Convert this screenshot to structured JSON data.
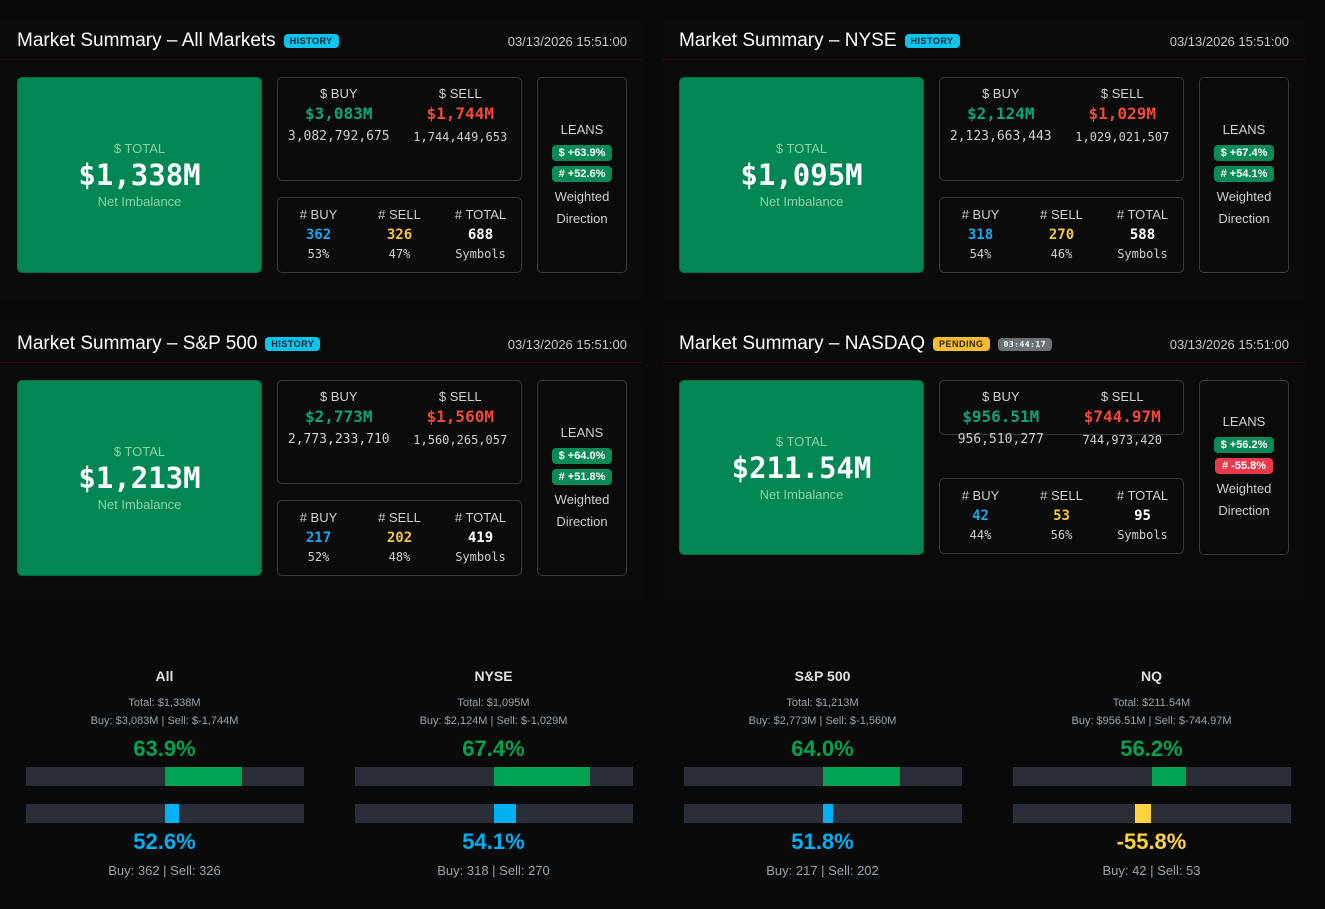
{
  "panels": [
    {
      "title": "Market Summary – All Markets",
      "badge": "HISTORY",
      "badge_type": "history",
      "time": "03/13/2026 15:51:00",
      "total_label": "$ TOTAL",
      "total": "$1,338M",
      "total_sub": "Net Imbalance",
      "buy_label": "$ BUY",
      "buy": "$3,083M",
      "buy_raw": "3,082,792,675",
      "sell_label": "$ SELL",
      "sell": "$1,744M",
      "sell_raw": "1,744,449,653",
      "nbuy_label": "# BUY",
      "nbuy": "362",
      "nbuy_pct": "53%",
      "nsell_label": "# SELL",
      "nsell": "326",
      "nsell_pct": "47%",
      "ntotal_label": "# TOTAL",
      "ntotal": "688",
      "ntotal_sub": "Symbols",
      "leans_label": "LEANS",
      "lean_dollar": "$ +63.9%",
      "lean_dollar_color": "#0a8a56",
      "lean_count": "# +52.6%",
      "lean_count_color": "#0a8a56",
      "leans_sub1": "Weighted",
      "leans_sub2": "Direction"
    },
    {
      "title": "Market Summary – NYSE",
      "badge": "HISTORY",
      "badge_type": "history",
      "time": "03/13/2026 15:51:00",
      "total_label": "$ TOTAL",
      "total": "$1,095M",
      "total_sub": "Net Imbalance",
      "buy_label": "$ BUY",
      "buy": "$2,124M",
      "buy_raw": "2,123,663,443",
      "sell_label": "$ SELL",
      "sell": "$1,029M",
      "sell_raw": "1,029,021,507",
      "nbuy_label": "# BUY",
      "nbuy": "318",
      "nbuy_pct": "54%",
      "nsell_label": "# SELL",
      "nsell": "270",
      "nsell_pct": "46%",
      "ntotal_label": "# TOTAL",
      "ntotal": "588",
      "ntotal_sub": "Symbols",
      "leans_label": "LEANS",
      "lean_dollar": "$ +67.4%",
      "lean_dollar_color": "#0a8a56",
      "lean_count": "# +54.1%",
      "lean_count_color": "#0a8a56",
      "leans_sub1": "Weighted",
      "leans_sub2": "Direction"
    },
    {
      "title": "Market Summary – S&P 500",
      "badge": "HISTORY",
      "badge_type": "history",
      "time": "03/13/2026 15:51:00",
      "total_label": "$ TOTAL",
      "total": "$1,213M",
      "total_sub": "Net Imbalance",
      "buy_label": "$ BUY",
      "buy": "$2,773M",
      "buy_raw": "2,773,233,710",
      "sell_label": "$ SELL",
      "sell": "$1,560M",
      "sell_raw": "1,560,265,057",
      "nbuy_label": "# BUY",
      "nbuy": "217",
      "nbuy_pct": "52%",
      "nsell_label": "# SELL",
      "nsell": "202",
      "nsell_pct": "48%",
      "ntotal_label": "# TOTAL",
      "ntotal": "419",
      "ntotal_sub": "Symbols",
      "leans_label": "LEANS",
      "lean_dollar": "$ +64.0%",
      "lean_dollar_color": "#0a8a56",
      "lean_count": "# +51.8%",
      "lean_count_color": "#0a8a56",
      "leans_sub1": "Weighted",
      "leans_sub2": "Direction"
    },
    {
      "title": "Market Summary – NASDAQ",
      "badge": "PENDING",
      "badge_type": "pending",
      "timer": "03:44:17",
      "time": "03/13/2026 15:51:00",
      "total_label": "$ TOTAL",
      "total": "$211.54M",
      "total_sub": "Net Imbalance",
      "buy_label": "$ BUY",
      "buy": "$956.51M",
      "buy_raw": "956,510,277",
      "sell_label": "$ SELL",
      "sell": "$744.97M",
      "sell_raw": "744,973,420",
      "nbuy_label": "# BUY",
      "nbuy": "42",
      "nbuy_pct": "44%",
      "nsell_label": "# SELL",
      "nsell": "53",
      "nsell_pct": "56%",
      "ntotal_label": "# TOTAL",
      "ntotal": "95",
      "ntotal_sub": "Symbols",
      "leans_label": "LEANS",
      "lean_dollar": "$ +56.2%",
      "lean_dollar_color": "#0a8a56",
      "lean_count": "# -55.8%",
      "lean_count_color": "#e83a4a",
      "leans_sub1": "Weighted",
      "leans_sub2": "Direction"
    }
  ],
  "summaries": [
    {
      "name": "All",
      "total": "Total: $1,338M",
      "buy": "Buy: $3,083M",
      "sell": "Sell: $-1,744M",
      "dollar_pct": "63.9%",
      "dollar_value": 63.9,
      "count_pct": "52.6%",
      "count_value": 52.6,
      "count_color": "#00b0f5",
      "foot_buy": "Buy: 362",
      "foot_sell": "Sell: 326"
    },
    {
      "name": "NYSE",
      "total": "Total: $1,095M",
      "buy": "Buy: $2,124M",
      "sell": "Sell: $-1,029M",
      "dollar_pct": "67.4%",
      "dollar_value": 67.4,
      "count_pct": "54.1%",
      "count_value": 54.1,
      "count_color": "#00b0f5",
      "foot_buy": "Buy: 318",
      "foot_sell": "Sell: 270"
    },
    {
      "name": "S&P 500",
      "total": "Total: $1,213M",
      "buy": "Buy: $2,773M",
      "sell": "Sell: $-1,560M",
      "dollar_pct": "64.0%",
      "dollar_value": 64.0,
      "count_pct": "51.8%",
      "count_value": 51.8,
      "count_color": "#00b0f5",
      "foot_buy": "Buy: 217",
      "foot_sell": "Sell: 202"
    },
    {
      "name": "NQ",
      "total": "Total: $211.54M",
      "buy": "Buy: $956.51M",
      "sell": "Sell: $-744.97M",
      "dollar_pct": "56.2%",
      "dollar_value": 56.2,
      "count_pct": "-55.8%",
      "count_value": -55.8,
      "count_color": "#ffd23f",
      "foot_buy": "Buy: 42",
      "foot_sell": "Sell: 53"
    }
  ],
  "colors": {
    "buy_green": "#00a352",
    "panel_green": "#018754",
    "sell_red": "#f04a3c",
    "buy_count_blue": "#1aa8f0",
    "sell_count_yellow": "#f5c83a"
  }
}
